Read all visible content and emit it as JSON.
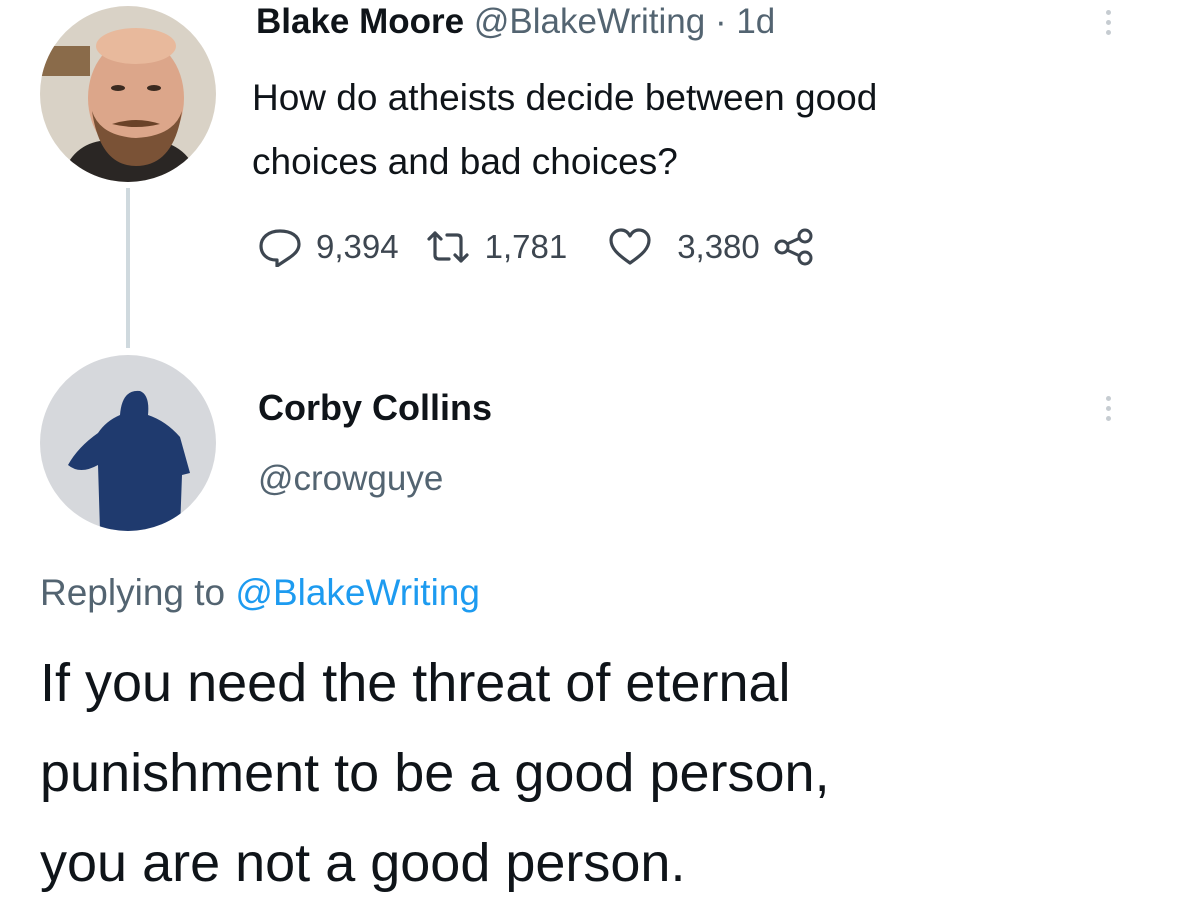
{
  "tweet": {
    "author_name": "Blake Moore",
    "author_handle": "@BlakeWriting",
    "separator": "·",
    "time": "1d",
    "text_line1": "How do atheists decide between good",
    "text_line2": "choices and bad choices?",
    "reply_count": "9,394",
    "retweet_count": "1,781",
    "like_count": "3,380",
    "icons": {
      "reply": "speech-bubble",
      "retweet": "retweet-arrows",
      "like": "heart",
      "share": "share-nodes",
      "more": "vertical-dots"
    }
  },
  "reply": {
    "author_name": "Corby Collins",
    "author_handle": "@crowguye",
    "replying_to_prefix": "Replying to",
    "replying_to_handle": "@BlakeWriting",
    "text_line1": "If you need the threat of eternal",
    "text_line2": "punishment to be a good person,",
    "text_line3": "you are not a good person."
  },
  "colors": {
    "text": "#0f1419",
    "muted": "#536471",
    "link": "#1d9bf0",
    "thread_line": "#cfd9de"
  }
}
